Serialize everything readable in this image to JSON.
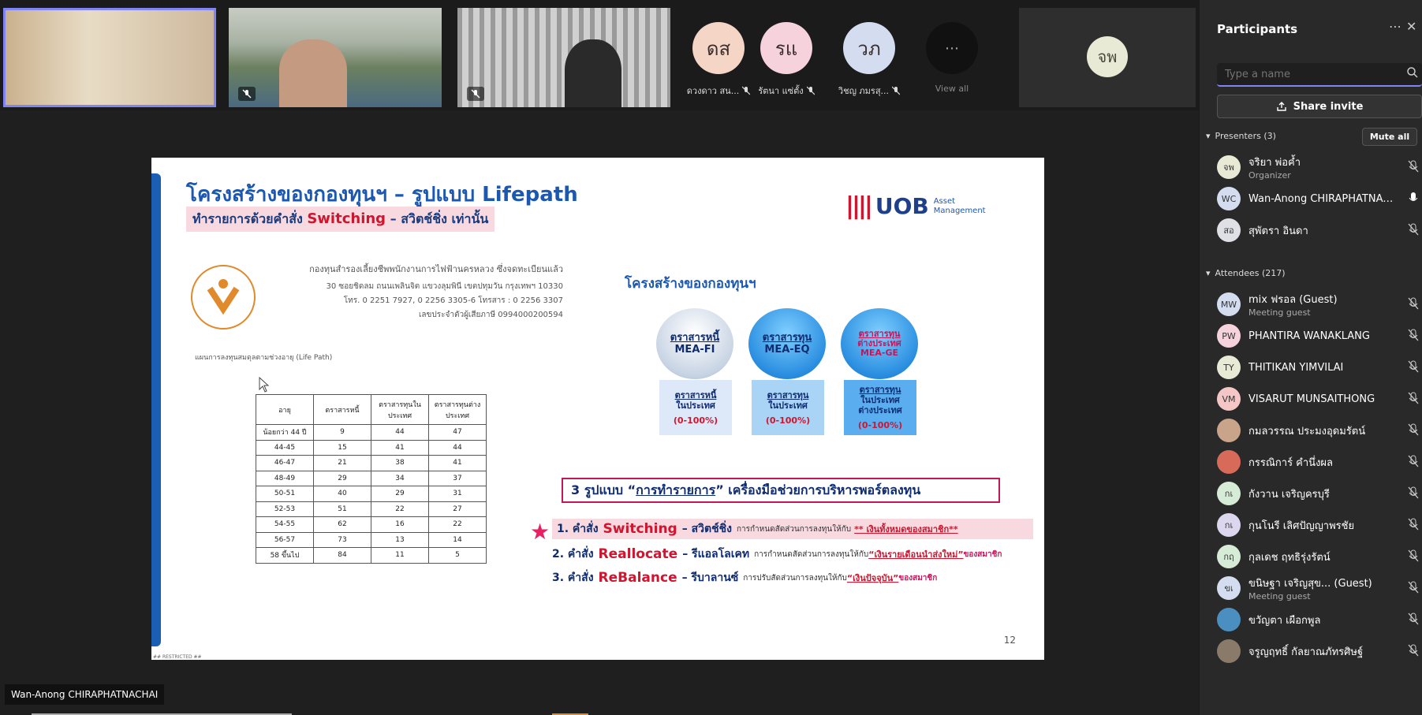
{
  "video_strip": {
    "avatars": [
      {
        "initials": "ดส",
        "name": "ดวงดาว สน...",
        "color": "#f5d6c6"
      },
      {
        "initials": "รแ",
        "name": "รัตนา แซ่ตั้ง",
        "color": "#f5d2dc"
      },
      {
        "initials": "วภ",
        "name": "วิชญ ภมรสุ...",
        "color": "#d4dcef"
      }
    ],
    "view_all_label": "View all",
    "featured_initials": "จพ"
  },
  "slide": {
    "title": "โครงสร้างของกองทุนฯ – รูปแบบ Lifepath",
    "subtitle_pre": "ทำรายการด้วยคำสั่ง ",
    "subtitle_switch": "Switching",
    "subtitle_post": " – สวิตช์ชิ่ง เท่านั้น",
    "logo_word": "UOB",
    "logo_sub1": "Asset",
    "logo_sub2": "Management",
    "fund_name": "กองทุนสำรองเลี้ยงชีพพนักงานการไฟฟ้านครหลวง  ซึ่งจดทะเบียนแล้ว",
    "fund_addr1": "30  ซอยชิดลม  ถนนเพลินจิต  แขวงลุมพินี  เขตปทุมวัน  กรุงเทพฯ 10330",
    "fund_addr2": "โทร. 0 2251 7927, 0 2256 3305-6  โทรสาร : 0 2256 3307",
    "fund_addr3": "เลขประจำตัวผู้เสียภาษี  0994000200594",
    "plan_label": "แผนการลงทุนสมดุลตามช่วงอายุ (Life Path)",
    "table_headers": [
      "อายุ",
      "ตราสารหนี้",
      "ตราสารทุนในประเทศ",
      "ตราสารทุนต่างประเทศ"
    ],
    "table_rows": [
      [
        "น้อยกว่า 44 ปี",
        "9",
        "44",
        "47"
      ],
      [
        "44-45",
        "15",
        "41",
        "44"
      ],
      [
        "46-47",
        "21",
        "38",
        "41"
      ],
      [
        "48-49",
        "29",
        "34",
        "37"
      ],
      [
        "50-51",
        "40",
        "29",
        "31"
      ],
      [
        "52-53",
        "51",
        "22",
        "27"
      ],
      [
        "54-55",
        "62",
        "16",
        "22"
      ],
      [
        "56-57",
        "73",
        "13",
        "14"
      ],
      [
        "58 ขึ้นไป",
        "84",
        "11",
        "5"
      ]
    ],
    "struct_title": "โครงสร้างของกองทุนฯ",
    "funds": [
      {
        "circle1": "ตราสารหนี้",
        "circle2": "MEA-FI",
        "box1": "ตราสารหนี้",
        "box2": "ในประเทศ",
        "box3": "",
        "range": "(0-100%)"
      },
      {
        "circle1": "ตราสารทุน",
        "circle2": "MEA-EQ",
        "box1": "ตราสารทุน",
        "box2": "ในประเทศ",
        "box3": "",
        "range": "(0-100%)"
      },
      {
        "circle1": "ตราสารทุน",
        "circle2": "ต่างประเทศ",
        "circle3": "MEA-GE",
        "box1": "ตราสารทุน",
        "box2": "ในประเทศ",
        "box3": "ต่างประเทศ",
        "range": "(0-100%)"
      }
    ],
    "three_types_pre": "3 รูปแบบ “",
    "three_types_u": "การทำรายการ",
    "three_types_post": "” เครื่องมือช่วยการบริหารพอร์ตลงทุน",
    "commands": [
      {
        "num": "1. คำสั่ง",
        "big": "Switching",
        "thai": "– สวิตช์ชิ่ง",
        "desc": "การกำหนดสัดส่วนการลงทุนให้กับ",
        "hl": "** เงินทั้งหมดของสมาชิก**",
        "tail": ""
      },
      {
        "num": "2. คำสั่ง",
        "big": "Reallocate",
        "thai": "– รีแอลโลเคท",
        "desc": "การกำหนดสัดส่วนการลงทุนให้กับ",
        "hl": "“เงินรายเดือนนำส่งใหม่”",
        "tail": " ของสมาชิก"
      },
      {
        "num": "3. คำสั่ง",
        "big": "ReBalance",
        "thai": "– รีบาลานซ์",
        "desc": "การปรับสัดส่วนการลงทุนให้กับ",
        "hl": "“เงินปัจจุบัน”",
        "tail": "ของสมาชิก"
      }
    ],
    "page_number": "12",
    "restricted": "## RESTRICTED ##"
  },
  "presenter_name_tag": "Wan-Anong CHIRAPHATNACHAI",
  "panel": {
    "title": "Participants",
    "search_placeholder": "Type a name",
    "share_invite": "Share invite",
    "presenters_label": "Presenters (3)",
    "mute_all": "Mute all",
    "attendees_label": "Attendees (217)",
    "presenters": [
      {
        "initials": "จพ",
        "name": "จริยา พ่อค้ำ",
        "role": "Organizer",
        "color": "#e8ead6",
        "mic": "off"
      },
      {
        "initials": "WC",
        "name": "Wan-Anong CHIRAPHATNAC...",
        "role": "",
        "color": "#d4dcef",
        "mic": "on"
      },
      {
        "initials": "สอ",
        "name": "สุพัตรา อินดา",
        "role": "",
        "color": "#dfe0e6",
        "mic": "off"
      }
    ],
    "attendees": [
      {
        "initials": "MW",
        "name": "mix ฟรอล (Guest)",
        "role": "Meeting guest",
        "color": "#d4dcef"
      },
      {
        "initials": "PW",
        "name": "PHANTIRA WANAKLANG",
        "role": "",
        "color": "#f5d2dc"
      },
      {
        "initials": "TY",
        "name": "THITIKAN YIMVILAI",
        "role": "",
        "color": "#e8ead6"
      },
      {
        "initials": "VM",
        "name": "VISARUT MUNSAITHONG",
        "role": "",
        "color": "#f5c6c6"
      },
      {
        "initials": "",
        "name": "กมลวรรณ ประมงอุดมรัตน์",
        "role": "",
        "color": "#caa48a"
      },
      {
        "initials": "",
        "name": "กรรณิการ์ คำนึ่งผล",
        "role": "",
        "color": "#d86a5a"
      },
      {
        "initials": "กเ",
        "name": "กังวาน เจริญครบุรี",
        "role": "",
        "color": "#d6ecd6"
      },
      {
        "initials": "กเ",
        "name": "กุนโนรี เลิศปัญญาพรชัย",
        "role": "",
        "color": "#dcd6ef"
      },
      {
        "initials": "กฤ",
        "name": "กุลเดช ฤทธิรุ่งรัตน์",
        "role": "",
        "color": "#d6ecd6"
      },
      {
        "initials": "ขเ",
        "name": "ขนิษฐา เจริญสุข... (Guest)",
        "role": "Meeting guest",
        "color": "#d4dcef"
      },
      {
        "initials": "",
        "name": "ขวัญตา เผือกพูล",
        "role": "",
        "color": "#4a8fc0"
      },
      {
        "initials": "",
        "name": "จรูญฤทธิ์ กัลยาณภัทรศิษฐ์",
        "role": "",
        "color": "#8a7a6a"
      }
    ]
  }
}
